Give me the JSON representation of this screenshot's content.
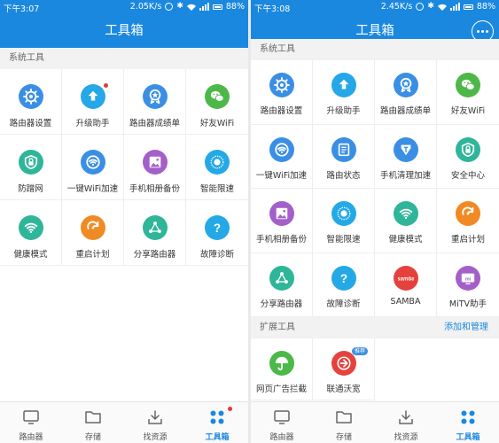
{
  "left": {
    "status": {
      "time": "下午3:07",
      "speed": "2.05K/s",
      "battery": "88%"
    },
    "title": "工具箱",
    "section": "系统工具",
    "tools": [
      {
        "label": "路由器设置",
        "icon": "gear-icon",
        "color": "#3a8fe4"
      },
      {
        "label": "升级助手",
        "icon": "upgrade-arrow-icon",
        "color": "#26a7e8"
      },
      {
        "label": "路由器成绩单",
        "icon": "medal-star-icon",
        "color": "#3a8fe4"
      },
      {
        "label": "好友WiFi",
        "icon": "wechat-icon",
        "color": "#4cb848"
      },
      {
        "label": "防蹭网",
        "icon": "shield-lock-icon",
        "color": "#2fb59a"
      },
      {
        "label": "一键WiFi加速",
        "icon": "wifi-boost-icon",
        "color": "#3a8fe4"
      },
      {
        "label": "手机相册备份",
        "icon": "photo-album-icon",
        "color": "#a45fc8"
      },
      {
        "label": "智能限速",
        "icon": "speed-limit-icon",
        "color": "#24a9e6"
      },
      {
        "label": "健康模式",
        "icon": "wifi-health-icon",
        "color": "#2fb59a"
      },
      {
        "label": "重启计划",
        "icon": "restart-icon",
        "color": "#f08a24"
      },
      {
        "label": "分享路由器",
        "icon": "share-icon",
        "color": "#2fb59a"
      },
      {
        "label": "故障诊断",
        "icon": "question-icon",
        "color": "#24a9e6"
      }
    ],
    "tabs": [
      {
        "label": "路由器",
        "icon": "router-tab-icon"
      },
      {
        "label": "存储",
        "icon": "folder-tab-icon"
      },
      {
        "label": "找资源",
        "icon": "download-tab-icon"
      },
      {
        "label": "工具箱",
        "icon": "grid-tab-icon"
      }
    ]
  },
  "right": {
    "status": {
      "time": "下午3:08",
      "speed": "2.45K/s",
      "battery": "88%"
    },
    "title": "工具箱",
    "section": "系统工具",
    "tools": [
      {
        "label": "路由器设置",
        "icon": "gear-icon",
        "color": "#3a8fe4"
      },
      {
        "label": "升级助手",
        "icon": "upgrade-arrow-icon",
        "color": "#26a7e8"
      },
      {
        "label": "路由器成绩单",
        "icon": "medal-star-icon",
        "color": "#3a8fe4"
      },
      {
        "label": "好友WiFi",
        "icon": "wechat-icon",
        "color": "#4cb848"
      },
      {
        "label": "一键WiFi加速",
        "icon": "wifi-boost-icon",
        "color": "#3a8fe4"
      },
      {
        "label": "路由状态",
        "icon": "status-list-icon",
        "color": "#3a8fe4"
      },
      {
        "label": "手机清理加速",
        "icon": "cleanup-icon",
        "color": "#3a8fe4"
      },
      {
        "label": "安全中心",
        "icon": "shield-lock-icon",
        "color": "#2fb59a"
      },
      {
        "label": "手机相册备份",
        "icon": "photo-album-icon",
        "color": "#a45fc8"
      },
      {
        "label": "智能限速",
        "icon": "speed-limit-icon",
        "color": "#24a9e6"
      },
      {
        "label": "健康模式",
        "icon": "wifi-health-icon",
        "color": "#2fb59a"
      },
      {
        "label": "重启计划",
        "icon": "restart-icon",
        "color": "#f08a24"
      },
      {
        "label": "分享路由器",
        "icon": "share-icon",
        "color": "#2fb59a"
      },
      {
        "label": "故障诊断",
        "icon": "question-icon",
        "color": "#24a9e6"
      },
      {
        "label": "SAMBA",
        "icon": "samba-icon",
        "color": "#e6423d"
      },
      {
        "label": "MiTV助手",
        "icon": "mitv-icon",
        "color": "#a45fc8"
      }
    ],
    "ext_section": "扩展工具",
    "ext_action": "添加和管理",
    "ext_tools": [
      {
        "label": "网页广告拦截",
        "icon": "umbrella-icon",
        "color": "#4cb848"
      },
      {
        "label": "联通沃宽",
        "icon": "unicom-speed-icon",
        "color": "#e6423d",
        "badge": "推荐"
      }
    ],
    "tabs": [
      {
        "label": "路由器",
        "icon": "router-tab-icon"
      },
      {
        "label": "存储",
        "icon": "folder-tab-icon"
      },
      {
        "label": "找资源",
        "icon": "download-tab-icon"
      },
      {
        "label": "工具箱",
        "icon": "grid-tab-icon"
      }
    ]
  }
}
